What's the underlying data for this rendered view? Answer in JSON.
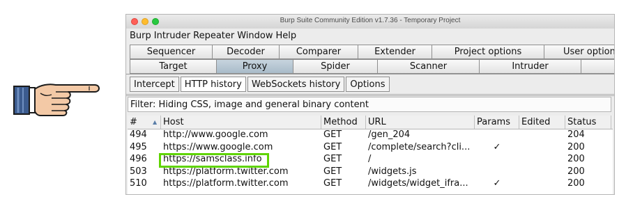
{
  "window": {
    "title": "Burp Suite Community Edition v1.7.36 - Temporary Project"
  },
  "menu": [
    "Burp",
    "Intruder",
    "Repeater",
    "Window",
    "Help"
  ],
  "tabs_row1": [
    "Sequencer",
    "Decoder",
    "Comparer",
    "Extender",
    "Project options",
    "User options"
  ],
  "tabs_row2": [
    "Target",
    "Proxy",
    "Spider",
    "Scanner",
    "Intruder",
    ""
  ],
  "active_main_tab": "Proxy",
  "subtabs": [
    "Intercept",
    "HTTP history",
    "WebSockets history",
    "Options"
  ],
  "active_subtab": "HTTP history",
  "filter": {
    "text": "Filter: Hiding CSS, image and general binary content"
  },
  "table": {
    "columns": [
      "#",
      "Host",
      "Method",
      "URL",
      "Params",
      "Edited",
      "Status"
    ],
    "rows": [
      {
        "num": "494",
        "host": "http://www.google.com",
        "method": "GET",
        "url": "/gen_204",
        "params": "",
        "edited": "",
        "status": "204"
      },
      {
        "num": "495",
        "host": "https://www.google.com",
        "method": "GET",
        "url": "/complete/search?cli...",
        "params": "✓",
        "edited": "",
        "status": "200"
      },
      {
        "num": "496",
        "host": "https://samsclass.info",
        "method": "GET",
        "url": "/",
        "params": "",
        "edited": "",
        "status": "200"
      },
      {
        "num": "503",
        "host": "https://platform.twitter.com",
        "method": "GET",
        "url": "/widgets.js",
        "params": "",
        "edited": "",
        "status": "200"
      },
      {
        "num": "510",
        "host": "https://platform.twitter.com",
        "method": "GET",
        "url": "/widgets/widget_ifra...",
        "params": "✓",
        "edited": "",
        "status": "200"
      }
    ]
  },
  "colors": {
    "highlight": "#5fd400",
    "active_tab": "#b3c3d0"
  },
  "icons": {
    "pointer": "pointing-hand-icon",
    "sort": "sort-ascending-icon"
  }
}
